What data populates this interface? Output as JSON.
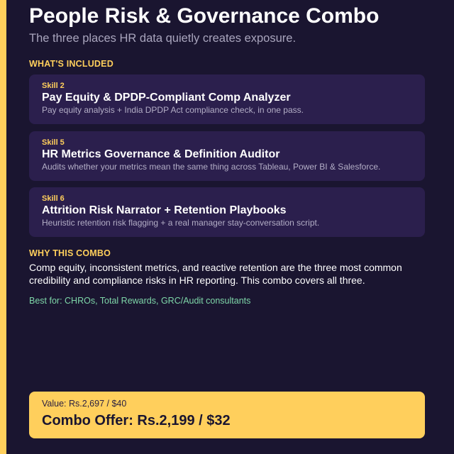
{
  "header": {
    "title": "People Risk & Governance Combo",
    "subtitle": "The three places HR data quietly creates exposure."
  },
  "included": {
    "heading": "WHAT'S INCLUDED",
    "cards": [
      {
        "tag": "Skill 2",
        "title": "Pay Equity & DPDP-Compliant Comp Analyzer",
        "description": "Pay equity analysis + India DPDP Act compliance check, in one pass."
      },
      {
        "tag": "Skill 5",
        "title": "HR Metrics Governance & Definition Auditor",
        "description": "Audits whether your metrics mean the same thing across Tableau, Power BI & Salesforce."
      },
      {
        "tag": "Skill 6",
        "title": "Attrition Risk Narrator + Retention Playbooks",
        "description": "Heuristic retention risk flagging + a real manager stay-conversation script."
      }
    ]
  },
  "why": {
    "heading": "WHY THIS COMBO",
    "text": "Comp equity, inconsistent metrics, and reactive retention are the three most common credibility and compliance risks in HR reporting. This combo covers all three.",
    "best_for": "Best for: CHROs, Total Rewards, GRC/Audit consultants"
  },
  "offer": {
    "value": "Value: Rs.2,697 / $40",
    "price": "Combo Offer: Rs.2,199 / $32"
  },
  "colors": {
    "background": "#1a1530",
    "accent": "#ffcf5c",
    "card": "#2b1f4d",
    "best_for": "#7ed6a8"
  }
}
